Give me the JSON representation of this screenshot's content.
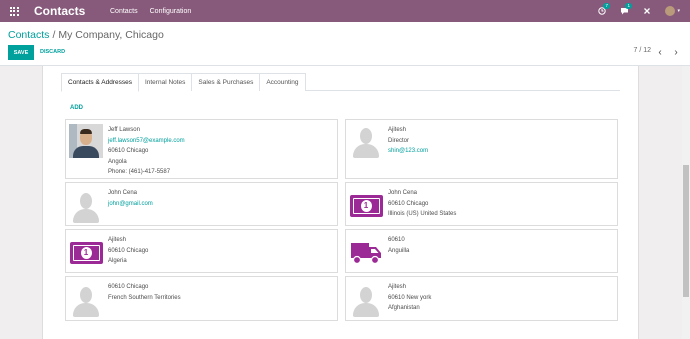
{
  "navbar": {
    "brand": "Contacts",
    "menu": [
      "Contacts",
      "Configuration"
    ],
    "activity_count": "7",
    "message_count": "1"
  },
  "breadcrumb": {
    "parent": "Contacts",
    "separator": "/",
    "current": "My Company, Chicago"
  },
  "buttons": {
    "save": "SAVE",
    "discard": "DISCARD"
  },
  "pager": {
    "label": "7 / 12"
  },
  "tabs": [
    "Contacts & Addresses",
    "Internal Notes",
    "Sales & Purchases",
    "Accounting"
  ],
  "add_label": "ADD",
  "colors": {
    "brand": "#875a7b",
    "accent": "#00a09d",
    "address_icon": "#9c2a96"
  },
  "contacts": [
    {
      "image": "photo",
      "lines": [
        {
          "text": "Jeff Lawson",
          "kind": "name"
        },
        {
          "text": "jeff.lawson57@example.com",
          "kind": "email"
        },
        {
          "text": "60610 Chicago",
          "kind": "text"
        },
        {
          "text": "Angola",
          "kind": "text"
        },
        {
          "text": "Phone: (461)-417-5587",
          "kind": "text"
        }
      ]
    },
    {
      "image": "placeholder-person",
      "lines": [
        {
          "text": "Ajitesh",
          "kind": "name"
        },
        {
          "text": "Director",
          "kind": "text"
        },
        {
          "text": "shin@123.com",
          "kind": "email"
        }
      ]
    },
    {
      "image": "placeholder-person",
      "lines": [
        {
          "text": "John Cena",
          "kind": "name"
        },
        {
          "text": "john@gmail.com",
          "kind": "email"
        }
      ]
    },
    {
      "image": "money-icon",
      "lines": [
        {
          "text": "John Cena",
          "kind": "name"
        },
        {
          "text": "60610 Chicago",
          "kind": "text"
        },
        {
          "text": "Illinois (US) United States",
          "kind": "text"
        }
      ]
    },
    {
      "image": "money-icon",
      "lines": [
        {
          "text": "Ajitesh",
          "kind": "name"
        },
        {
          "text": "60610 Chicago",
          "kind": "text"
        },
        {
          "text": "Algeria",
          "kind": "text"
        }
      ]
    },
    {
      "image": "truck-icon",
      "lines": [
        {
          "text": "60610",
          "kind": "text"
        },
        {
          "text": "Anguilla",
          "kind": "text"
        }
      ]
    },
    {
      "image": "placeholder-person",
      "lines": [
        {
          "text": "60610 Chicago",
          "kind": "text"
        },
        {
          "text": "French Southern Territories",
          "kind": "text"
        }
      ]
    },
    {
      "image": "placeholder-person",
      "lines": [
        {
          "text": "Ajitesh",
          "kind": "name"
        },
        {
          "text": "60610 New york",
          "kind": "text"
        },
        {
          "text": "Afghanistan",
          "kind": "text"
        }
      ]
    }
  ]
}
